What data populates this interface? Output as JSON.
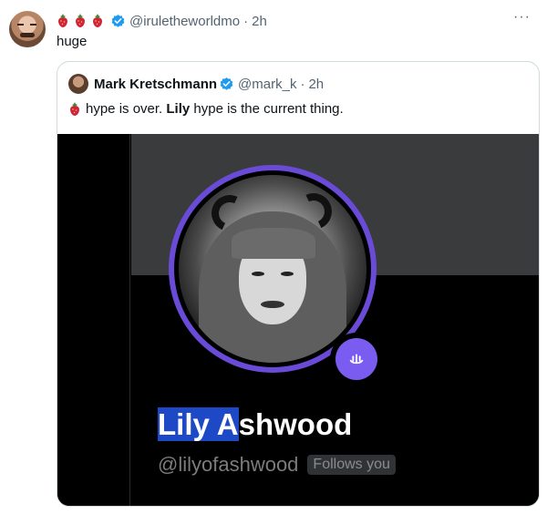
{
  "tweet": {
    "handle": "@irulethe​worldmo",
    "time": "2h",
    "text": "huge",
    "strawberry_count": 3
  },
  "quote": {
    "name": "Mark Kretschmann",
    "handle": "@mark_k",
    "time": "2h",
    "text_part1": "hype is over.",
    "text_bold": "Lily",
    "text_part2": "hype is the current thing."
  },
  "profile_card": {
    "display_name_selected": "Lily A",
    "display_name_rest": "shwood",
    "handle": "@lilyofashwood",
    "follows_badge": "Follows you"
  },
  "colors": {
    "verified": "#1d9bf0",
    "ring": "#6a4bd8",
    "badge": "#7b5cf0",
    "selection": "#1d49c7"
  },
  "icons": {
    "more": "more-icon",
    "verified": "verified-badge-icon",
    "strawberry": "strawberry-icon"
  }
}
